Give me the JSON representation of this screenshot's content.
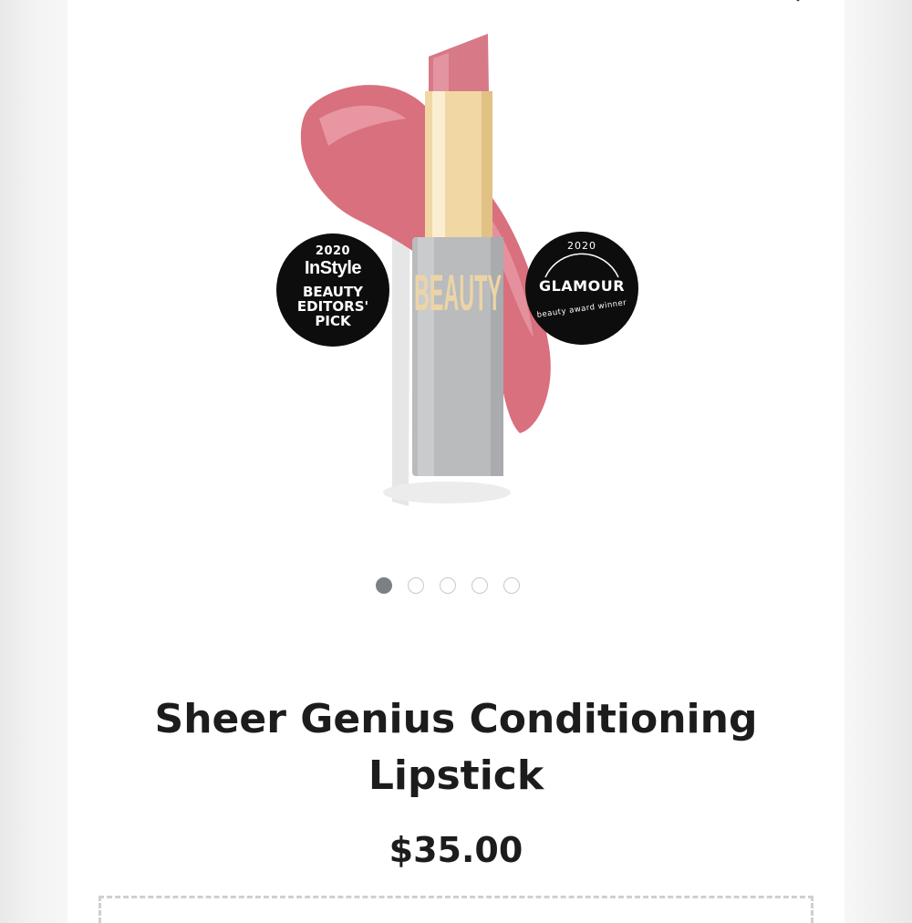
{
  "product": {
    "title_line1": "Sheer Genius Conditioning",
    "title_line2": "Lipstick",
    "price": "$35.00",
    "tube_brand": "BEAUTY",
    "swatch_color": "#d9707e",
    "bullet_color": "#d77986",
    "tube_gold": "#f1d7a4",
    "tube_gray": "#b9bbbd"
  },
  "badges": {
    "instyle": {
      "year": "2020",
      "brand": "InStyle",
      "line1": "BEAUTY",
      "line2": "EDITORS'",
      "line3": "PICK"
    },
    "glamour": {
      "year": "2020",
      "name": "GLAMOUR",
      "award": "beauty award winner"
    }
  },
  "carousel": {
    "total": 5,
    "active_index": 0
  },
  "colors": {
    "text": "#1c1c1c",
    "dot_active": "#7b8087",
    "dot_inactive": "#c8c8c8"
  }
}
